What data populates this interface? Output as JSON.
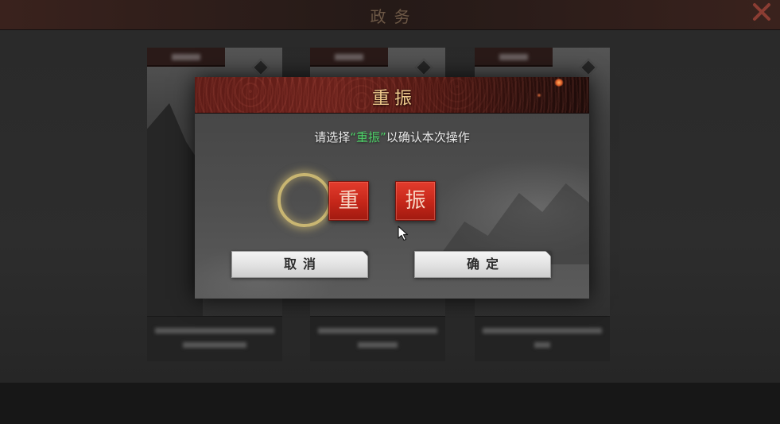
{
  "screen": {
    "title": "政务",
    "close_icon": "close-icon"
  },
  "dialog": {
    "title": "重振",
    "prompt": {
      "before": "请选择",
      "highlight": "“重振”",
      "after": "以确认本次操作"
    },
    "tiles": [
      {
        "char": "重"
      },
      {
        "char": "振"
      }
    ],
    "selection_indicator": "ring-icon",
    "cancel_label": "取消",
    "confirm_label": "确定"
  },
  "cursor_icon": "mouse-pointer-icon",
  "colors": {
    "highlight_green": "#4fd36a",
    "title_gold": "#edc98c",
    "tile_red": "#c42619"
  }
}
